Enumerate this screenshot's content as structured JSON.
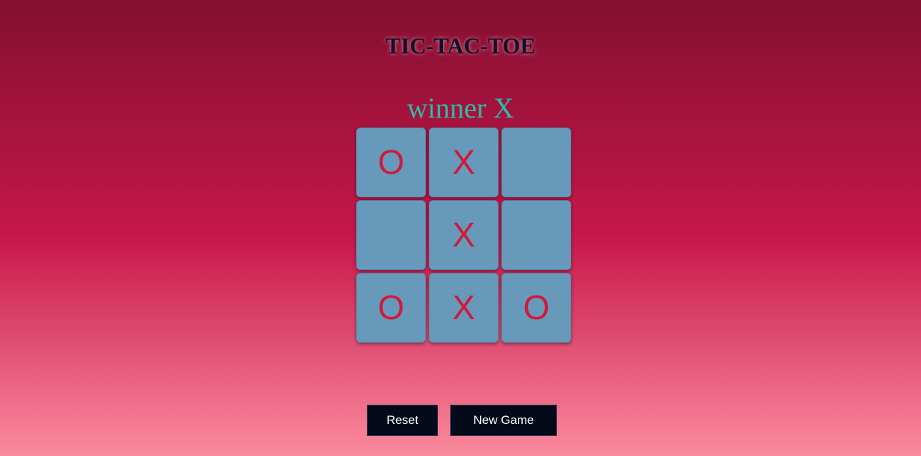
{
  "title": "TIC-TAC-TOE",
  "status": "winner X",
  "board": {
    "cells": [
      "O",
      "X",
      "",
      "",
      "X",
      "",
      "O",
      "X",
      "O"
    ]
  },
  "buttons": {
    "reset_label": "Reset",
    "new_game_label": "New Game"
  },
  "colors": {
    "cell": "#679aba",
    "mark": "#d01a3c",
    "status": "#34b8a6",
    "button": "#050a1b"
  }
}
